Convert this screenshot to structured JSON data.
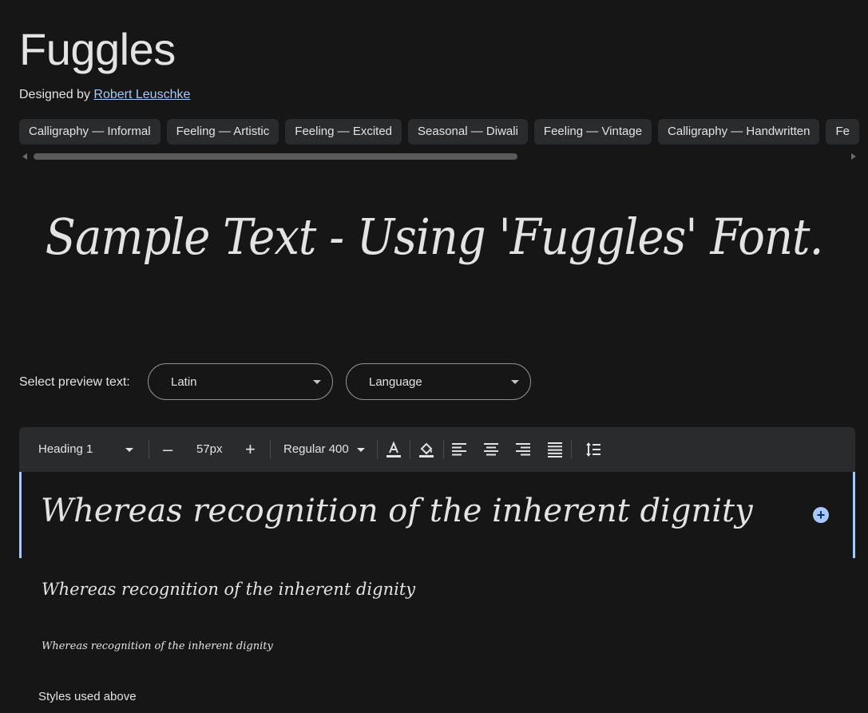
{
  "font": {
    "name": "Fuggles",
    "designed_by_label": "Designed by",
    "designer": "Robert Leuschke"
  },
  "tags": [
    "Calligraphy — Informal",
    "Feeling — Artistic",
    "Feeling — Excited",
    "Seasonal — Diwali",
    "Feeling — Vintage",
    "Calligraphy — Handwritten",
    "Fe"
  ],
  "sample_text": "Sample Text - Using 'Fuggles' Font.",
  "preview": {
    "label": "Select preview text:",
    "script_select": "Latin",
    "language_select": "Language"
  },
  "toolbar": {
    "style_select": "Heading 1",
    "size": "57px",
    "weight_select": "Regular 400",
    "minus": "–",
    "plus": "+"
  },
  "preview_rows": [
    "Whereas recognition of the inherent dignity",
    "Whereas recognition of the inherent dignity",
    "Whereas recognition of the inherent dignity"
  ],
  "add_row_symbol": "+",
  "styles_used_label": "Styles used above",
  "colors": {
    "background": "#161616",
    "surface": "#2a2b2d",
    "accent": "#a8c7fa",
    "text": "#e3e3e3"
  }
}
